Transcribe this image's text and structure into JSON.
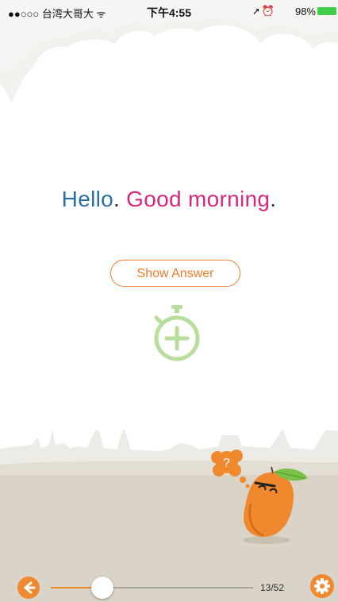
{
  "status_bar": {
    "carrier": "●●○○○ 台湾大哥大 ᯤ",
    "time": "下午4:55",
    "battery": "98%"
  },
  "card": {
    "phrase_en": "Hello",
    "phrase_cn": "Good morning",
    "punct_1": ".",
    "punct_2": ".",
    "show_answer_label": "Show Answer"
  },
  "bottom_bar": {
    "progress_text": "13/52",
    "progress_fraction": 0.25
  },
  "colors": {
    "accent": "#f0892e",
    "english": "#2b6ea3",
    "chinese": "#d6297a",
    "timer": "#b8dd9c",
    "ground": "#d9d4c7"
  },
  "icons": {
    "back": "arrow-left-icon",
    "settings": "gear-icon",
    "timer": "stopwatch-plus-icon",
    "thought": "question-bubble-icon"
  }
}
